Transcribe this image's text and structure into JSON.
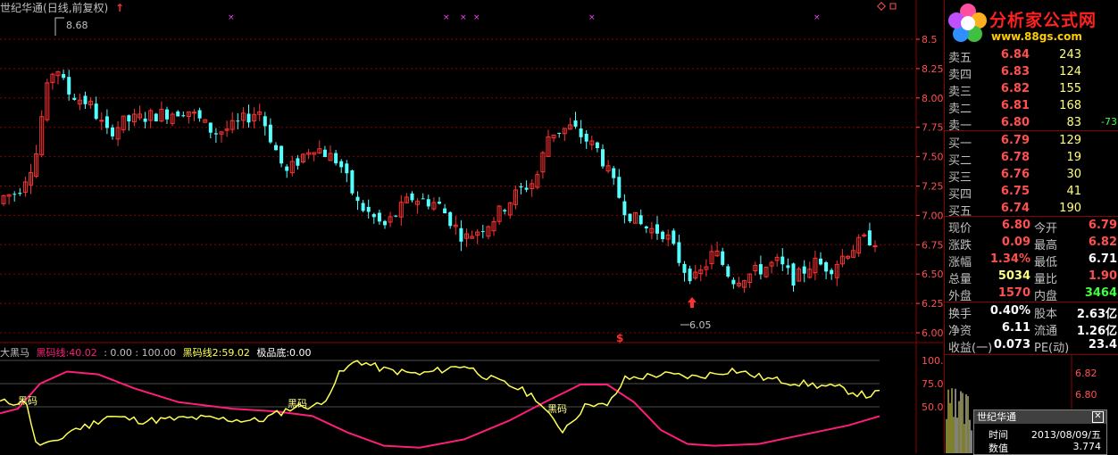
{
  "title": {
    "name": "世纪华通",
    "mode": "(日线,前复权)"
  },
  "price_axis": {
    "labels": [
      "8.5",
      "8.25",
      "8.00",
      "7.75",
      "7.50",
      "7.25",
      "7.00",
      "6.75",
      "6.50",
      "6.25",
      "6.00"
    ]
  },
  "ind_axis": {
    "labels": [
      "100.",
      "75.00",
      "50.00"
    ]
  },
  "annotations": {
    "high": "8.68",
    "low": "6.05",
    "marker": "$"
  },
  "indicator": {
    "name": "大黑马",
    "line1_label": "黑码线:",
    "line1_val": "40.02",
    "mid": ": 0.00 : 100.00",
    "line2_label": "黑码线2:",
    "line2_val": "59.02",
    "bottom_label": "极品底:",
    "bottom_val": "0.00"
  },
  "ind_text": {
    "t1": "黑码",
    "t2": "黑码",
    "t3": "黑码"
  },
  "logo": {
    "text": "分析家公式网",
    "url": "www.88gs.com"
  },
  "sell": [
    {
      "label": "卖五",
      "price": "6.84",
      "vol": "243",
      "chg": ""
    },
    {
      "label": "卖四",
      "price": "6.83",
      "vol": "124",
      "chg": ""
    },
    {
      "label": "卖三",
      "price": "6.82",
      "vol": "155",
      "chg": ""
    },
    {
      "label": "卖二",
      "price": "6.81",
      "vol": "168",
      "chg": ""
    },
    {
      "label": "卖一",
      "price": "6.80",
      "vol": "83",
      "chg": "-73"
    }
  ],
  "buy": [
    {
      "label": "买一",
      "price": "6.79",
      "vol": "129"
    },
    {
      "label": "买二",
      "price": "6.78",
      "vol": "19"
    },
    {
      "label": "买三",
      "price": "6.76",
      "vol": "30"
    },
    {
      "label": "买四",
      "price": "6.75",
      "vol": "41"
    },
    {
      "label": "买五",
      "price": "6.74",
      "vol": "190"
    }
  ],
  "quote1": [
    {
      "l1": "现价",
      "v1": "6.80",
      "c1": "#ff5050",
      "l2": "今开",
      "v2": "6.79",
      "c2": "#ff5050"
    },
    {
      "l1": "涨跌",
      "v1": "0.09",
      "c1": "#ff5050",
      "l2": "最高",
      "v2": "6.82",
      "c2": "#ff5050"
    },
    {
      "l1": "涨幅",
      "v1": "1.34%",
      "c1": "#ff5050",
      "l2": "最低",
      "v2": "6.71",
      "c2": "#ffffff"
    },
    {
      "l1": "总量",
      "v1": "5034",
      "c1": "#ffff80",
      "l2": "量比",
      "v2": "1.90",
      "c2": "#ff5050"
    },
    {
      "l1": "外盘",
      "v1": "1570",
      "c1": "#ff5050",
      "l2": "内盘",
      "v2": "3464",
      "c2": "#40ff40"
    }
  ],
  "quote2": [
    {
      "l1": "换手",
      "v1": "0.40%",
      "c1": "#ffffff",
      "l2": "股本",
      "v2": "2.63亿",
      "c2": "#ffffff"
    },
    {
      "l1": "净资",
      "v1": "6.11",
      "c1": "#ffffff",
      "l2": "流通",
      "v2": "1.26亿",
      "c2": "#ffffff"
    },
    {
      "l1": "收益(一)",
      "v1": "0.073",
      "c1": "#ffffff",
      "l2": "PE(动)",
      "v2": "23.4",
      "c2": "#ffffff"
    }
  ],
  "mini_axis": {
    "a": "6.82",
    "b": "6.80"
  },
  "popup": {
    "title": "世纪华通",
    "close": "✕",
    "time_label": "时间",
    "time_val": "2013/08/09/五",
    "val_label": "数值",
    "val_val": "3.774"
  },
  "colors": {
    "up": "#ff3232",
    "down": "#54ffff",
    "grid": "#8b0000",
    "yellow": "#ffff54",
    "magenta": "#ff1d7a"
  }
}
